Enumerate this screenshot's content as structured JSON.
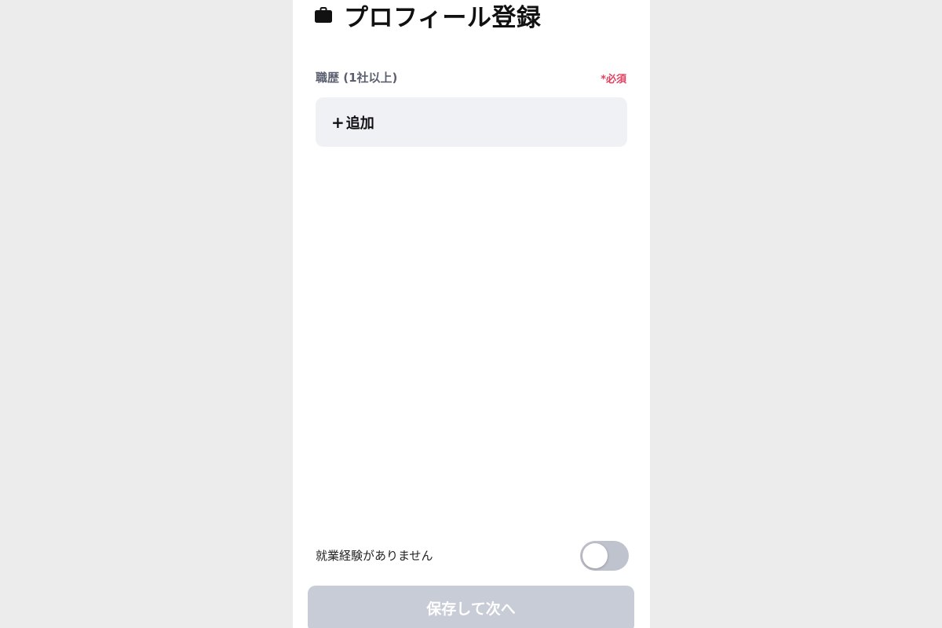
{
  "header": {
    "title": "プロフィール登録",
    "icon": "briefcase-icon"
  },
  "work_history": {
    "label": "職歴 (1社以上)",
    "required": "*必須",
    "add_plus": "+",
    "add_label": "追加"
  },
  "no_experience": {
    "label": "就業経験がありません",
    "enabled": false
  },
  "footer": {
    "submit_label": "保存して次へ"
  },
  "colors": {
    "required": "#e0405f",
    "toggle_off": "#bfc3cd",
    "button_disabled": "#c8ccd6",
    "add_box_bg": "#f0f1f5"
  }
}
